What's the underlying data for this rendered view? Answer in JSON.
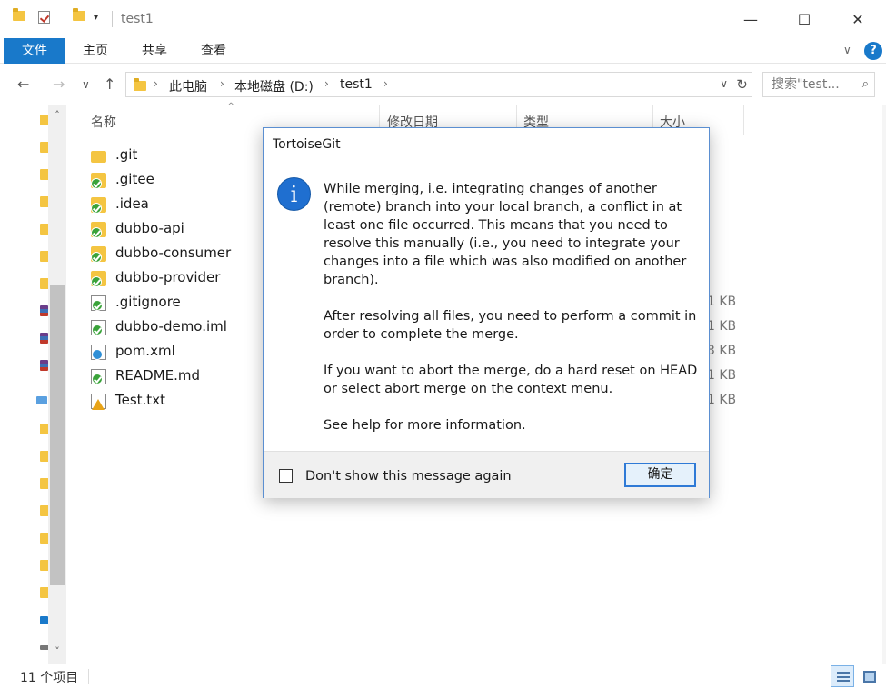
{
  "window": {
    "title": "test1",
    "qa_dropdown": "▾",
    "minimize": "—",
    "maximize": "☐",
    "close": "✕"
  },
  "ribbon": {
    "tabs": [
      "文件",
      "主页",
      "共享",
      "查看"
    ],
    "collapse": "∨",
    "help": "?"
  },
  "nav": {
    "back": "←",
    "forward": "→",
    "recent": "∨",
    "up": "↑",
    "breadcrumb": [
      "此电脑",
      "本地磁盘 (D:)",
      "test1"
    ],
    "crumb_sep": "›",
    "address_dropdown": "∨",
    "refresh": "↻",
    "search_placeholder": "搜索\"test...",
    "search_icon": "⌕"
  },
  "columns": {
    "name": "名称",
    "modified": "修改日期",
    "type": "类型",
    "size": "大小"
  },
  "files": [
    {
      "name": ".git",
      "icon": "folder-icon",
      "badge": "none",
      "size": ""
    },
    {
      "name": ".gitee",
      "icon": "folder-icon",
      "badge": "ok",
      "size": ""
    },
    {
      "name": ".idea",
      "icon": "folder-icon",
      "badge": "ok",
      "size": ""
    },
    {
      "name": "dubbo-api",
      "icon": "folder-icon",
      "badge": "ok",
      "size": ""
    },
    {
      "name": "dubbo-consumer",
      "icon": "folder-icon",
      "badge": "ok",
      "size": ""
    },
    {
      "name": "dubbo-provider",
      "icon": "folder-icon",
      "badge": "ok",
      "size": ""
    },
    {
      "name": ".gitignore",
      "icon": "file-icon",
      "badge": "ok",
      "size": "1 KB"
    },
    {
      "name": "dubbo-demo.iml",
      "icon": "file-icon",
      "badge": "ok",
      "size": "1 KB"
    },
    {
      "name": "pom.xml",
      "icon": "file-icon",
      "badge": "mod",
      "size": "3 KB"
    },
    {
      "name": "README.md",
      "icon": "file-icon",
      "badge": "ok",
      "size": "1 KB"
    },
    {
      "name": "Test.txt",
      "icon": "file-icon",
      "badge": "warn",
      "size": "1 KB"
    }
  ],
  "status": {
    "item_count": "11 个项目"
  },
  "dialog": {
    "title": "TortoiseGit",
    "icon": "i",
    "paragraphs": [
      "While merging, i.e. integrating changes of another (remote) branch into your local branch, a conflict in at least one file occurred. This means that you need to resolve this manually (i.e., you need to integrate your changes into a file which was also modified on another branch).",
      "After resolving all files, you need to perform a commit in order to complete the merge.",
      "If you want to abort the merge, do a hard reset on HEAD or select abort merge on the context menu.",
      "See help for more information."
    ],
    "checkbox_label": "Don't show this message again",
    "checkbox_checked": false,
    "ok_label": "确定"
  },
  "scroll": {
    "up": "˄",
    "down": "˅"
  }
}
